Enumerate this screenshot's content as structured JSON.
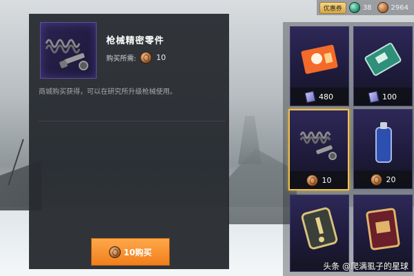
{
  "topbar": {
    "voucher_label": "优惠券",
    "currency_green_value": "38",
    "currency_bronze_value": "2964"
  },
  "item": {
    "title": "枪械精密零件",
    "price_label": "购买所需:",
    "price_value": "10",
    "description": "商城购买获得，可以在研究所升级枪械使用。",
    "buy_label": "10购买"
  },
  "grid": {
    "cells": [
      {
        "name": "orange-ticket",
        "price": "480",
        "currency": "ticket-icon"
      },
      {
        "name": "green-card",
        "price": "100",
        "currency": "ticket-icon"
      },
      {
        "name": "precision-parts",
        "price": "10",
        "currency": "bronze-coin-icon",
        "selected": true
      },
      {
        "name": "spray-can",
        "price": "20",
        "currency": "bronze-coin-icon"
      },
      {
        "name": "exclamation-badge",
        "price": "",
        "currency": ""
      },
      {
        "name": "id-card",
        "price": "",
        "currency": ""
      }
    ]
  },
  "watermark": "头条 @爬满虱子的星球",
  "colors": {
    "accent_orange": "#f07f1c",
    "selected_border": "#f3c24a",
    "panel_bg": "#2a2e33",
    "cell_purple": "#2e2858"
  }
}
